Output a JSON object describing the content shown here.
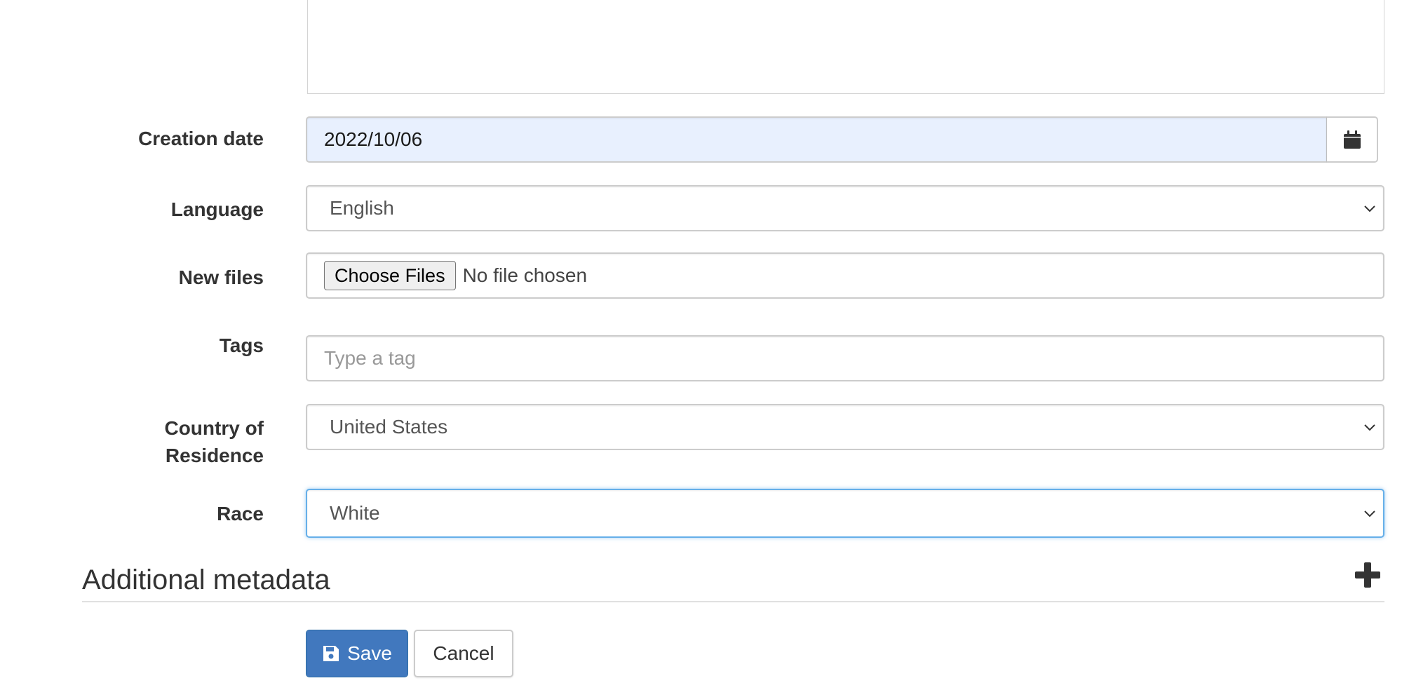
{
  "form": {
    "creation_date": {
      "label": "Creation date",
      "value": "2022/10/06",
      "icon": "calendar-icon"
    },
    "language": {
      "label": "Language",
      "value": "English"
    },
    "new_files": {
      "label": "New files",
      "button": "Choose Files",
      "status": "No file chosen"
    },
    "tags": {
      "label": "Tags",
      "placeholder": "Type a tag"
    },
    "country": {
      "label_line1": "Country of",
      "label_line2": "Residence",
      "value": "United States"
    },
    "race": {
      "label": "Race",
      "value": "White"
    }
  },
  "additional_metadata": {
    "heading": "Additional metadata",
    "icon": "plus-icon"
  },
  "actions": {
    "save_label": "Save",
    "cancel_label": "Cancel"
  },
  "colors": {
    "primary": "#4178be",
    "focus": "#66afe9",
    "autofill": "#e8f0fe"
  }
}
